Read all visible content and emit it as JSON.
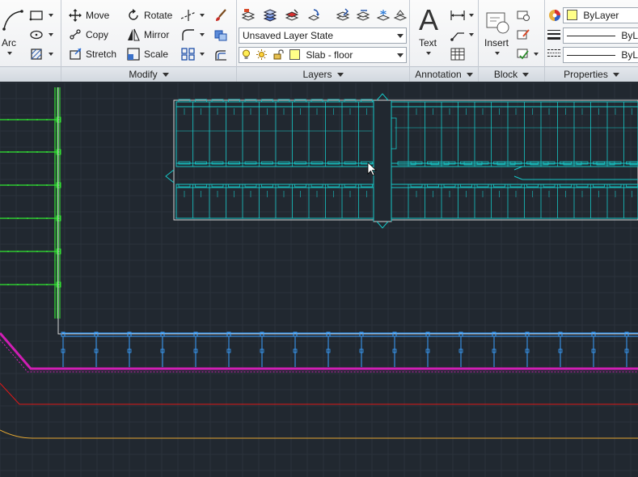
{
  "ribbon": {
    "draw_panel": {
      "arc_label": "Arc"
    },
    "modify_panel": {
      "title": "Modify",
      "move": "Move",
      "rotate": "Rotate",
      "copy": "Copy",
      "mirror": "Mirror",
      "stretch": "Stretch",
      "scale": "Scale"
    },
    "layers_panel": {
      "title": "Layers",
      "layer_state": "Unsaved Layer State",
      "current_layer": "Slab - floor"
    },
    "annotation_panel": {
      "title": "Annotation",
      "text_label": "Text",
      "text_glyph": "A"
    },
    "block_panel": {
      "title": "Block",
      "insert_label": "Insert"
    },
    "properties_panel": {
      "title": "Properties",
      "color": "ByLayer",
      "lineweight": "ByLa",
      "linetype": "ByLa"
    }
  },
  "colors": {
    "canvas_bg": "#212830",
    "grid": "#2c343d",
    "cyan": "#17c6c6",
    "green": "#32e632",
    "blue": "#3aa0ff",
    "magenta": "#d01eb4",
    "red": "#e01818",
    "orange": "#e6a832",
    "layer_swatch": "#ffff88"
  }
}
